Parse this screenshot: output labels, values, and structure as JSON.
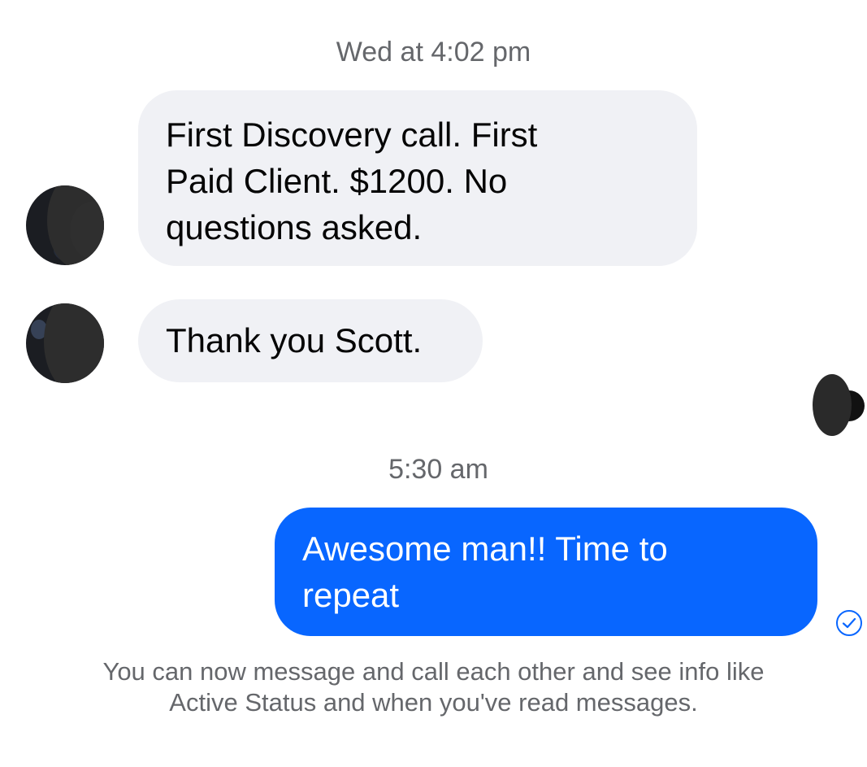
{
  "thread": {
    "timestamp_1": "Wed at 4:02 pm",
    "message_1_lines": [
      "First Discovery call. First",
      "Paid Client. $1200. No",
      "questions asked."
    ],
    "message_2": "Thank you Scott.",
    "timestamp_2": "5:30 am",
    "message_3_lines": [
      "Awesome man!! Time to",
      "repeat"
    ],
    "notice_lines": [
      "You can now message and call each other and see info like",
      "Active Status and when you've read messages."
    ]
  },
  "icons": {
    "contact_avatar": "avatar-icon",
    "seen_avatar": "seen-avatar-icon",
    "sent_status": "sent-check-icon"
  },
  "colors": {
    "incoming_bubble": "#f0f1f5",
    "outgoing_bubble": "#0866ff",
    "meta_text": "#65676b",
    "sent_icon": "#0866ff"
  }
}
